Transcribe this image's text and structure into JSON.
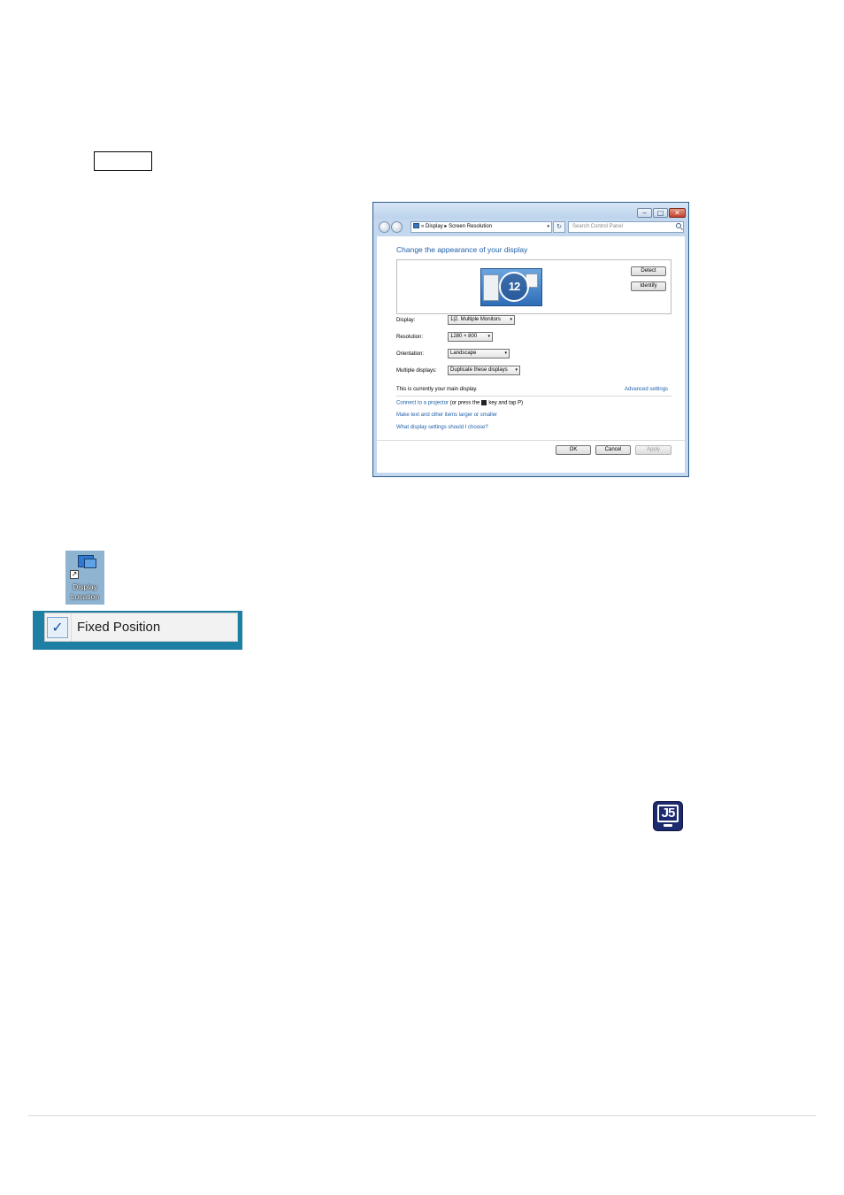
{
  "window": {
    "title_buttons": {
      "minimize": "‒",
      "maximize": "□",
      "close": "✕"
    },
    "breadcrumb": {
      "prefix": "«",
      "crumb1": "Display",
      "separator": "▸",
      "crumb2": "Screen Resolution",
      "dropdown": "▾"
    },
    "refresh_glyph": "↻",
    "search_placeholder": "Search Control Panel",
    "page_title": "Change the appearance of your display",
    "monitor_label": "12",
    "buttons": {
      "detect": "Detect",
      "identify": "Identify",
      "ok": "OK",
      "cancel": "Cancel",
      "apply": "Apply"
    },
    "fields": {
      "display": {
        "label": "Display:",
        "value": "1|2. Multiple Monitors"
      },
      "resolution": {
        "label": "Resolution:",
        "value": "1280 × 800"
      },
      "orientation": {
        "label": "Orientation:",
        "value": "Landscape"
      },
      "multiple_displays": {
        "label": "Multiple displays:",
        "value": "Duplicate these displays"
      }
    },
    "dropdown_arrow": "▾",
    "main_display_text": "This is currently your main display.",
    "advanced_link": "Advanced settings",
    "projector": {
      "link": "Connect to a projector",
      "mid": "(or press the",
      "end": "key and tap P)"
    },
    "text_larger_link": "Make text and other items larger or smaller",
    "which_settings_link": "What display settings should I choose?"
  },
  "shortcut": {
    "label": "Display\nLocation",
    "overlay_glyph": "↗"
  },
  "menu": {
    "check_glyph": "✓",
    "item_label": "Fixed Position"
  },
  "j5_icon": {
    "text": "J5"
  },
  "colors": {
    "link": "#1e5fa8",
    "menu_bg": "#1e7fa4",
    "j5_bg": "#1c2a6e"
  }
}
